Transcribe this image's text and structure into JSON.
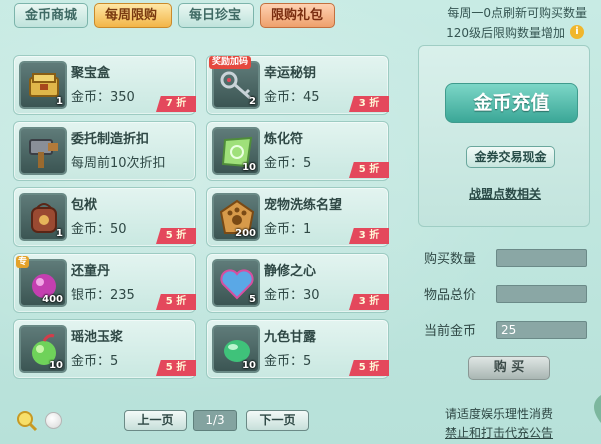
{
  "tabs": [
    {
      "label": "金币商城",
      "active": false
    },
    {
      "label": "每周限购",
      "active": true
    },
    {
      "label": "每日珍宝",
      "active": false
    },
    {
      "label": "限购礼包",
      "active": false
    }
  ],
  "info": {
    "line1": "每周一0点刷新可购买数量",
    "line2": "120级后限购数量增加",
    "icon": "i"
  },
  "items": [
    {
      "name": "聚宝盒",
      "price": "金币：350",
      "qty": "1",
      "discount": "7 折",
      "badge": "",
      "icon": "treasure-box-icon"
    },
    {
      "name": "幸运秘钥",
      "price": "金币：45",
      "qty": "2",
      "discount": "3 折",
      "badge": "奖励加码",
      "icon": "key-icon"
    },
    {
      "name": "委托制造折扣",
      "price": "每周前10次折扣",
      "qty": "",
      "discount": "",
      "badge": "",
      "icon": "hammer-icon"
    },
    {
      "name": "炼化符",
      "price": "金币：5",
      "qty": "10",
      "discount": "5 折",
      "badge": "",
      "icon": "talisman-icon"
    },
    {
      "name": "包袱",
      "price": "金币：50",
      "qty": "1",
      "discount": "5 折",
      "badge": "",
      "icon": "bag-icon"
    },
    {
      "name": "宠物洗练名望",
      "price": "金币：1",
      "qty": "200",
      "discount": "3 折",
      "badge": "",
      "icon": "paw-icon"
    },
    {
      "name": "还童丹",
      "price": "银币：235",
      "qty": "400",
      "discount": "5 折",
      "badge": "专",
      "icon": "pill-icon"
    },
    {
      "name": "静修之心",
      "price": "金币：30",
      "qty": "5",
      "discount": "3 折",
      "badge": "",
      "icon": "heart-icon"
    },
    {
      "name": "瑶池玉浆",
      "price": "金币：5",
      "qty": "10",
      "discount": "5 折",
      "badge": "",
      "icon": "green-fruit-icon"
    },
    {
      "name": "九色甘露",
      "price": "金币：5",
      "qty": "10",
      "discount": "5 折",
      "badge": "",
      "icon": "dew-icon"
    }
  ],
  "panel": {
    "recharge": "金币充值",
    "exchange": "金券交易现金",
    "link": "战盟点数相关"
  },
  "form": {
    "qty_label": "购买数量",
    "qty_value": "",
    "total_label": "物品总价",
    "total_value": "",
    "balance_label": "当前金币",
    "balance_value": "25",
    "buy": "购 买"
  },
  "pager": {
    "prev": "上一页",
    "page": "1/3",
    "next": "下一页"
  },
  "notice": {
    "line1": "请适度娱乐理性消费",
    "line2": "禁止和打击代充公告"
  },
  "colors": {
    "discount": "#e4485c",
    "accent": "#3ba797",
    "active_tab": "#f2b548"
  }
}
